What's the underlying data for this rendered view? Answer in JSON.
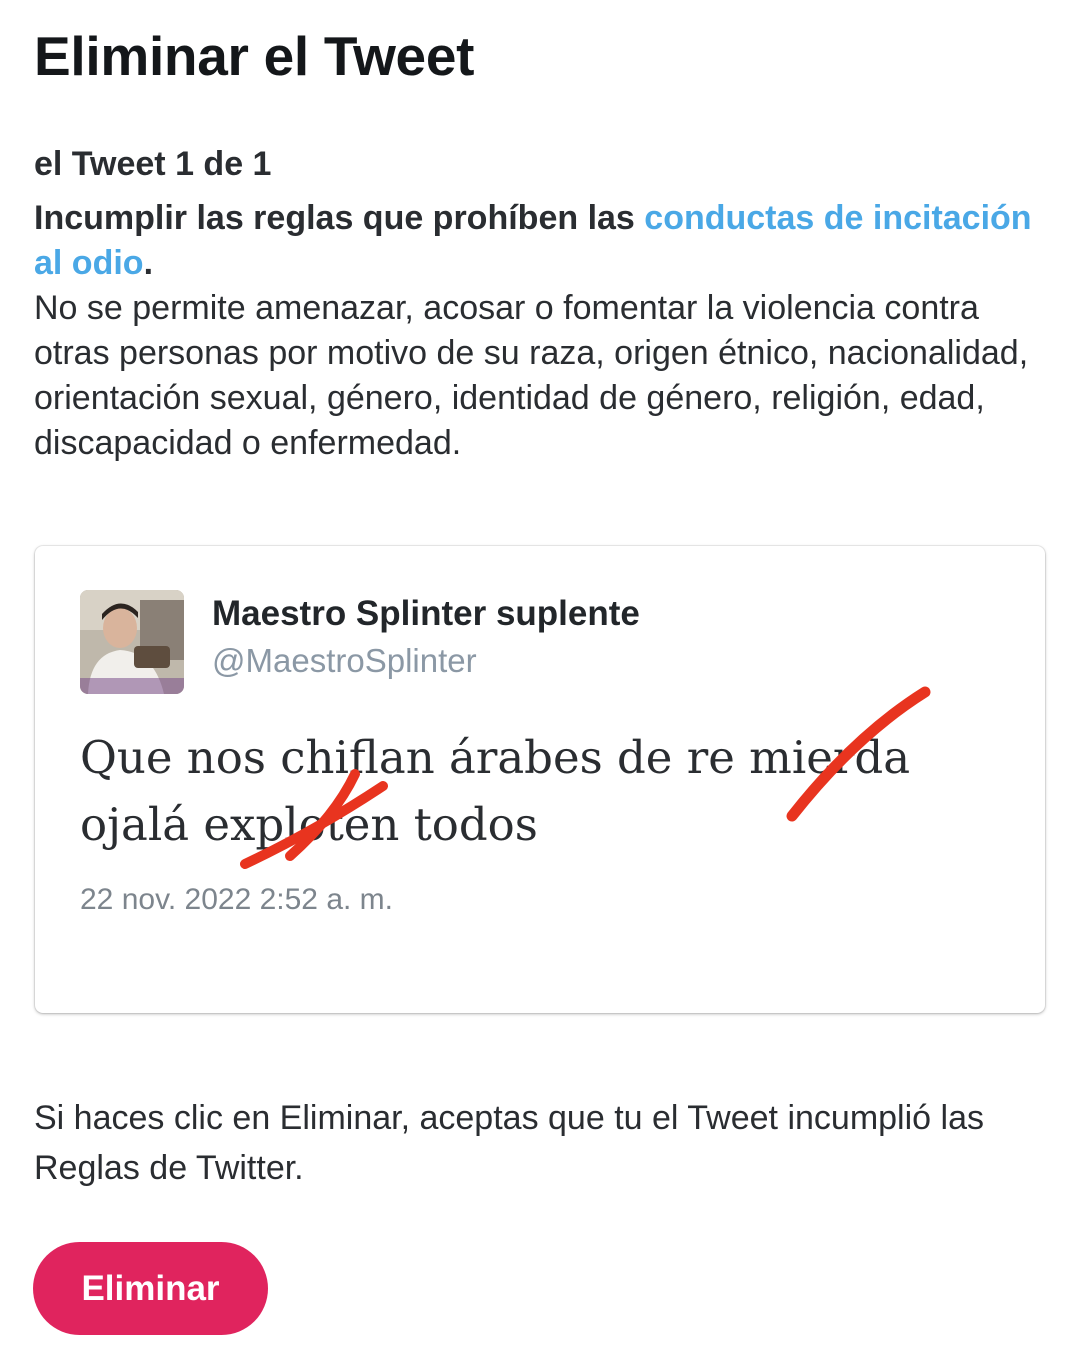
{
  "header": {
    "title": "Eliminar el Tweet"
  },
  "violation": {
    "counter": "el Tweet 1 de 1",
    "rule_prefix": "Incumplir las reglas que prohíben las ",
    "rule_link": "conductas de incitación al odio",
    "rule_suffix": ".",
    "description": "No se permite amenazar, acosar o fomentar la violencia contra otras personas por motivo de su raza, origen étnico, nacionalidad, orientación sexual, género, identidad de género, religión, edad, discapacidad o enfermedad."
  },
  "tweet": {
    "author_name": "Maestro Splinter suplente",
    "author_handle": "@MaestroSplinter",
    "text": "Que nos chiflan árabes de re mierda ojalá exploten todos",
    "timestamp": "22 nov. 2022 2:52 a. m."
  },
  "footer": {
    "notice": "Si haces clic en Eliminar, aceptas que tu el Tweet incumplió las Reglas de Twitter.",
    "delete_label": "Eliminar"
  },
  "colors": {
    "link": "#4aa8e6",
    "delete_button": "#e0245e",
    "scribble": "#e8341f"
  }
}
